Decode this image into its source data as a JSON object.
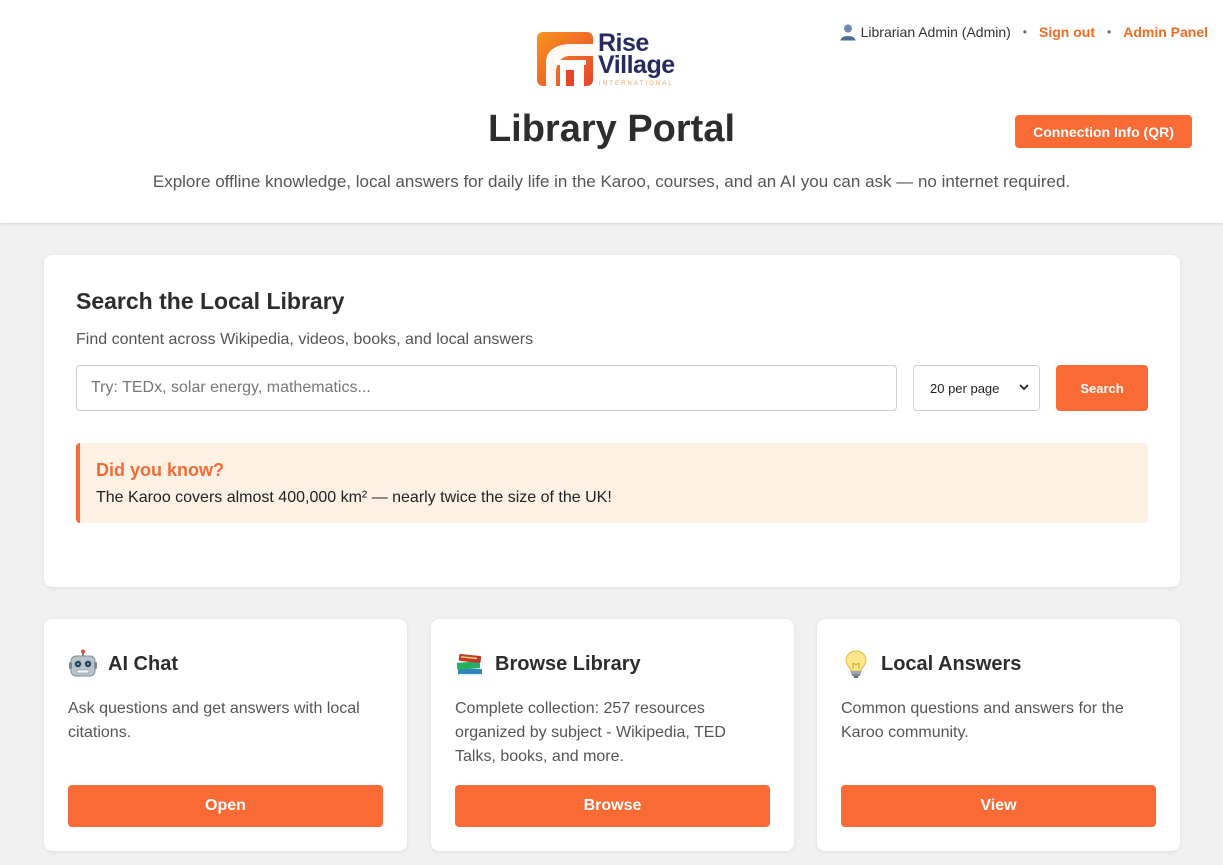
{
  "brand": {
    "logo_line1": "Rise",
    "logo_line2": "Village",
    "logo_line3": "INTERNATIONAL",
    "accent_color": "#f96a35",
    "navy_color": "#262a60"
  },
  "user_bar": {
    "user_icon": "user-icon",
    "user_label": "Librarian Admin (Admin)",
    "separator": "•",
    "sign_out": "Sign out",
    "admin_panel": "Admin Panel"
  },
  "header": {
    "title": "Library Portal",
    "connection_button": "Connection Info (QR)",
    "subtitle": "Explore offline knowledge, local answers for daily life in the Karoo, courses, and an AI you can ask — no internet required."
  },
  "search": {
    "heading": "Search the Local Library",
    "description": "Find content across Wikipedia, videos, books, and local answers",
    "placeholder": "Try: TEDx, solar energy, mathematics...",
    "value": "",
    "per_page_selected": "20 per page",
    "button": "Search"
  },
  "did_you_know": {
    "title": "Did you know?",
    "text": "The Karoo covers almost 400,000 km² — nearly twice the size of the UK!"
  },
  "cards": [
    {
      "icon": "robot-icon",
      "title": "AI Chat",
      "description": "Ask questions and get answers with local citations.",
      "button": "Open"
    },
    {
      "icon": "books-icon",
      "title": "Browse Library",
      "description": "Complete collection: 257 resources organized by subject - Wikipedia, TED Talks, books, and more.",
      "button": "Browse"
    },
    {
      "icon": "lightbulb-icon",
      "title": "Local Answers",
      "description": "Common questions and answers for the Karoo community.",
      "button": "View"
    }
  ]
}
